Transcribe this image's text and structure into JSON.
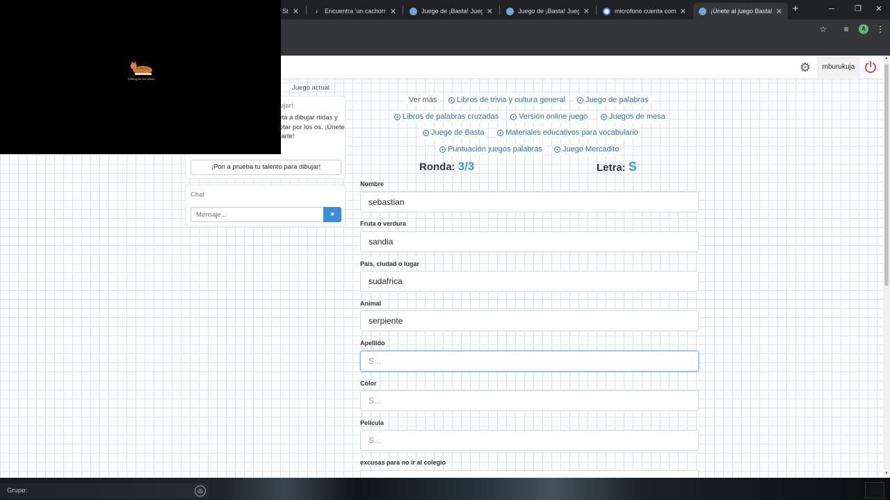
{
  "browser": {
    "tabs": [
      {
        "title": "St",
        "active": false
      },
      {
        "title": "Encuentra 'un cachorro fe",
        "active": false
      },
      {
        "title": "Juego de ¡Basta! Juega St",
        "active": false
      },
      {
        "title": "Juego de ¡Basta! Juega St",
        "active": false
      },
      {
        "title": "microfono cuenta como",
        "active": false
      },
      {
        "title": "¡Únete al juego Basta!",
        "active": true
      }
    ]
  },
  "pip": {
    "caption": "Looking for the phone"
  },
  "header": {
    "username": "mburukuja"
  },
  "breadcrumb": "Juego actual",
  "left_panel": {
    "card_title": "bujar!",
    "card_text": "reta a dibujar rtidas y votar por los os. ¡Únete y arte!",
    "draw_button": "¡Pon a prueba tu talento para dibujar!",
    "chat_title": "Chat",
    "chat_placeholder": "Mensaje..."
  },
  "links": {
    "ver_mas": "Ver más",
    "items": [
      "Libros de trivia y cultura general",
      "Juego de palabras",
      "Libros de palabras cruzadas",
      "Versión online juego",
      "Juegos de mesa",
      "Juego de Basta",
      "Materiales educativos para vocabulario",
      "Puntuación juegos palabras",
      "Juego Mercadito"
    ]
  },
  "game": {
    "ronda_label": "Ronda:",
    "ronda_value": "3/3",
    "letra_label": "Letra:",
    "letra_value": "S"
  },
  "fields": [
    {
      "label": "Nombre",
      "value": "sebastian",
      "placeholder": ""
    },
    {
      "label": "Fruta o verdura",
      "value": "sandia",
      "placeholder": ""
    },
    {
      "label": "País, ciudad o lugar",
      "value": "sudafrica",
      "placeholder": ""
    },
    {
      "label": "Animal",
      "value": "serpiente",
      "placeholder": ""
    },
    {
      "label": "Apellido",
      "value": "",
      "placeholder": "S..."
    },
    {
      "label": "Color",
      "value": "",
      "placeholder": "S..."
    },
    {
      "label": "Película",
      "value": "",
      "placeholder": "S..."
    },
    {
      "label": "excusas para no ir al colegio",
      "value": "",
      "placeholder": ""
    }
  ],
  "bottom": {
    "grupo_label": "Grupo:"
  },
  "colors": {
    "accent": "#3a9ad9",
    "link": "#2f6fb6",
    "power": "#d9363e"
  }
}
